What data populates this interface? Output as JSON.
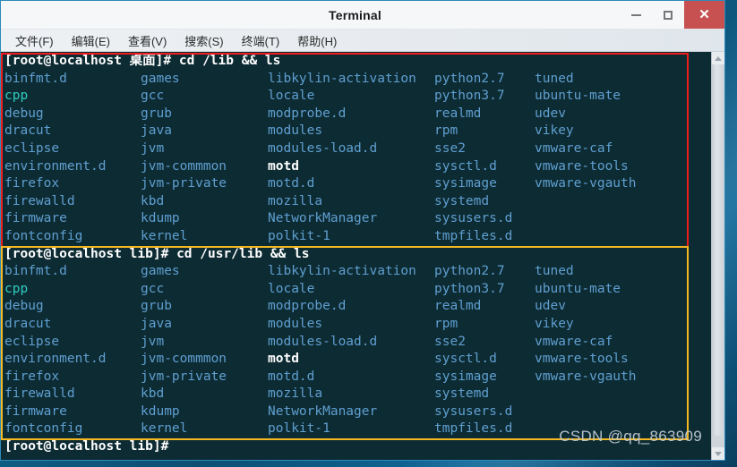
{
  "window": {
    "title": "Terminal",
    "controls": {
      "minimize": "minimize",
      "maximize": "maximize",
      "close": "✕"
    }
  },
  "menubar": {
    "items": [
      {
        "label": "文件(F)"
      },
      {
        "label": "编辑(E)"
      },
      {
        "label": "查看(V)"
      },
      {
        "label": "搜索(S)"
      },
      {
        "label": "终端(T)"
      },
      {
        "label": "帮助(H)"
      }
    ]
  },
  "terminal": {
    "background": "#0d2b33",
    "prompt_color": "#ffffff",
    "dir_color": "#5f9fd0",
    "link_color": "#2ecdc0",
    "blocks": [
      {
        "id": "lib-listing",
        "highlight_color": "#f01d1d",
        "prompt": "[root@localhost 桌面]# cd /lib && ls",
        "prompt_user": "[root@localhost 桌面]#",
        "command": "cd /lib && ls",
        "columns": [
          [
            "binfmt.d",
            "cpp",
            "debug",
            "dracut",
            "eclipse",
            "environment.d",
            "firefox",
            "firewalld",
            "firmware",
            "fontconfig"
          ],
          [
            "games",
            "gcc",
            "grub",
            "java",
            "jvm",
            "jvm-commmon",
            "jvm-private",
            "kbd",
            "kdump",
            "kernel"
          ],
          [
            "libkylin-activation",
            "locale",
            "modprobe.d",
            "modules",
            "modules-load.d",
            "motd",
            "motd.d",
            "mozilla",
            "NetworkManager",
            "polkit-1"
          ],
          [
            "python2.7",
            "python3.7",
            "realmd",
            "rpm",
            "sse2",
            "sysctl.d",
            "sysimage",
            "systemd",
            "sysusers.d",
            "tmpfiles.d"
          ],
          [
            "tuned",
            "ubuntu-mate",
            "udev",
            "vikey",
            "vmware-caf",
            "vmware-tools",
            "vmware-vgauth",
            "",
            "",
            ""
          ]
        ]
      },
      {
        "id": "usr-lib-listing",
        "highlight_color": "#f5b820",
        "prompt": "[root@localhost lib]# cd /usr/lib && ls",
        "prompt_user": "[root@localhost lib]#",
        "command": "cd /usr/lib && ls",
        "columns": [
          [
            "binfmt.d",
            "cpp",
            "debug",
            "dracut",
            "eclipse",
            "environment.d",
            "firefox",
            "firewalld",
            "firmware",
            "fontconfig"
          ],
          [
            "games",
            "gcc",
            "grub",
            "java",
            "jvm",
            "jvm-commmon",
            "jvm-private",
            "kbd",
            "kdump",
            "kernel"
          ],
          [
            "libkylin-activation",
            "locale",
            "modprobe.d",
            "modules",
            "modules-load.d",
            "motd",
            "motd.d",
            "mozilla",
            "NetworkManager",
            "polkit-1"
          ],
          [
            "python2.7",
            "python3.7",
            "realmd",
            "rpm",
            "sse2",
            "sysctl.d",
            "sysimage",
            "systemd",
            "sysusers.d",
            "tmpfiles.d"
          ],
          [
            "tuned",
            "ubuntu-mate",
            "udev",
            "vikey",
            "vmware-caf",
            "vmware-tools",
            "vmware-vgauth",
            "",
            "",
            ""
          ]
        ]
      }
    ],
    "final_prompt": "[root@localhost lib]#",
    "special_entries": {
      "symlink": "cpp",
      "bold_white": "motd"
    }
  },
  "watermark": {
    "text": "CSDN @qq_863909"
  },
  "scrollbar": {
    "up_arrow": "scroll-up",
    "down_arrow": "scroll-down",
    "thumb": "scroll-thumb"
  }
}
